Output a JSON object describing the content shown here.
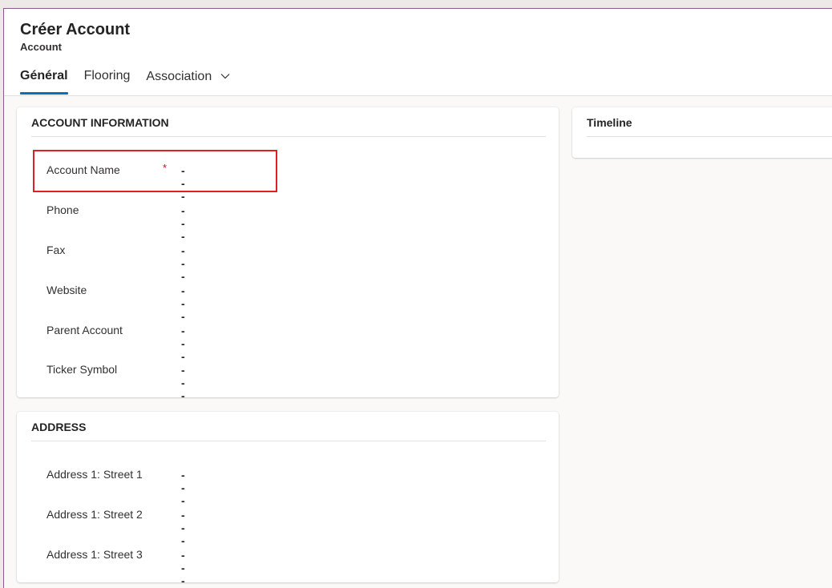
{
  "header": {
    "title": "Créer Account",
    "entity": "Account"
  },
  "tabs": [
    {
      "label": "Général",
      "active": true
    },
    {
      "label": "Flooring",
      "active": false
    },
    {
      "label": "Association",
      "active": false,
      "has_dropdown": true
    }
  ],
  "account_information": {
    "title": "ACCOUNT INFORMATION",
    "fields": [
      {
        "label": "Account Name",
        "value": "---",
        "required": true,
        "required_mark": "*"
      },
      {
        "label": "Phone",
        "value": "---"
      },
      {
        "label": "Fax",
        "value": "---"
      },
      {
        "label": "Website",
        "value": "---"
      },
      {
        "label": "Parent Account",
        "value": "---"
      },
      {
        "label": "Ticker Symbol",
        "value": "---"
      }
    ]
  },
  "address": {
    "title": "ADDRESS",
    "fields": [
      {
        "label": "Address 1: Street 1",
        "value": "---"
      },
      {
        "label": "Address 1: Street 2",
        "value": "---"
      },
      {
        "label": "Address 1: Street 3",
        "value": "---"
      }
    ]
  },
  "timeline": {
    "title": "Timeline"
  },
  "colors": {
    "accent": "#0f6cbd",
    "required": "#c50f1f",
    "highlight": "#e02020"
  },
  "icons": {
    "association_dropdown": "chevron-down-icon"
  }
}
